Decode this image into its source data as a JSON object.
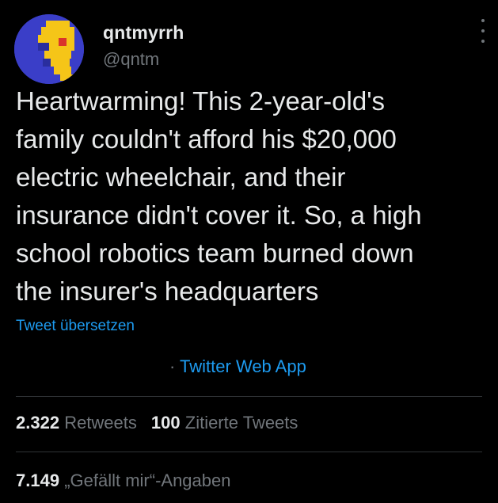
{
  "tweet": {
    "author": {
      "display_name": "qntmyrrh",
      "handle": "@qntm",
      "avatar_icon": "pixel-face-avatar"
    },
    "text": "Heartwarming! This 2-year-old's\nfamily couldn't afford his $20,000\nelectric wheelchair, and their\ninsurance didn't cover it. So, a high\nschool robotics team burned down\nthe insurer's headquarters",
    "translate_link": "Tweet übersetzen",
    "source_separator": "·",
    "source_app": "Twitter Web App",
    "stats": {
      "retweets_count": "2.322",
      "retweets_label": "Retweets",
      "quotes_count": "100",
      "quotes_label": "Zitierte Tweets",
      "likes_count": "7.149",
      "likes_label": "„Gefällt mir“-Angaben"
    }
  },
  "colors": {
    "background": "#000000",
    "text": "#e7e9ea",
    "secondary": "#71767b",
    "link": "#1d9bf0",
    "divider": "#2f3336"
  }
}
